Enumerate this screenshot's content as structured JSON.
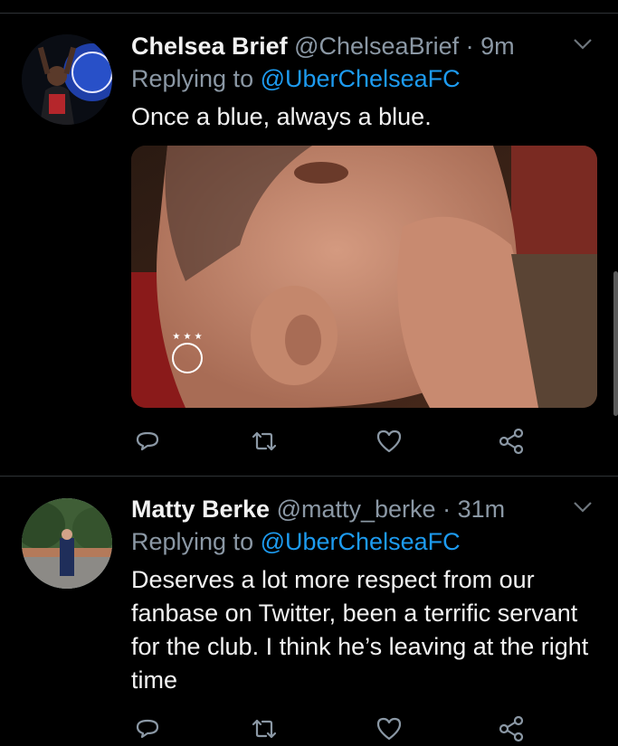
{
  "tweets": [
    {
      "name": "Chelsea Brief",
      "handle": "@ChelseaBrief",
      "separator": "·",
      "time": "9m",
      "replying_prefix": "Replying to",
      "replying_to": "@UberChelseaFC",
      "text": "Once a blue, always a blue.",
      "has_media": true
    },
    {
      "name": "Matty Berke",
      "handle": "@matty_berke",
      "separator": "·",
      "time": "31m",
      "replying_prefix": "Replying to",
      "replying_to": "@UberChelseaFC",
      "text": "Deserves a lot more respect from our fanbase on Twitter, been a terrific servant for the club. I think he’s leaving at the right time",
      "has_media": false
    }
  ],
  "icons": [
    "chevron-down-icon",
    "reply-icon",
    "retweet-icon",
    "like-icon",
    "share-icon"
  ],
  "colors": {
    "background": "#000000",
    "link": "#1d9bf0",
    "secondary_text": "#8b98a5",
    "divider": "#2f3336"
  }
}
